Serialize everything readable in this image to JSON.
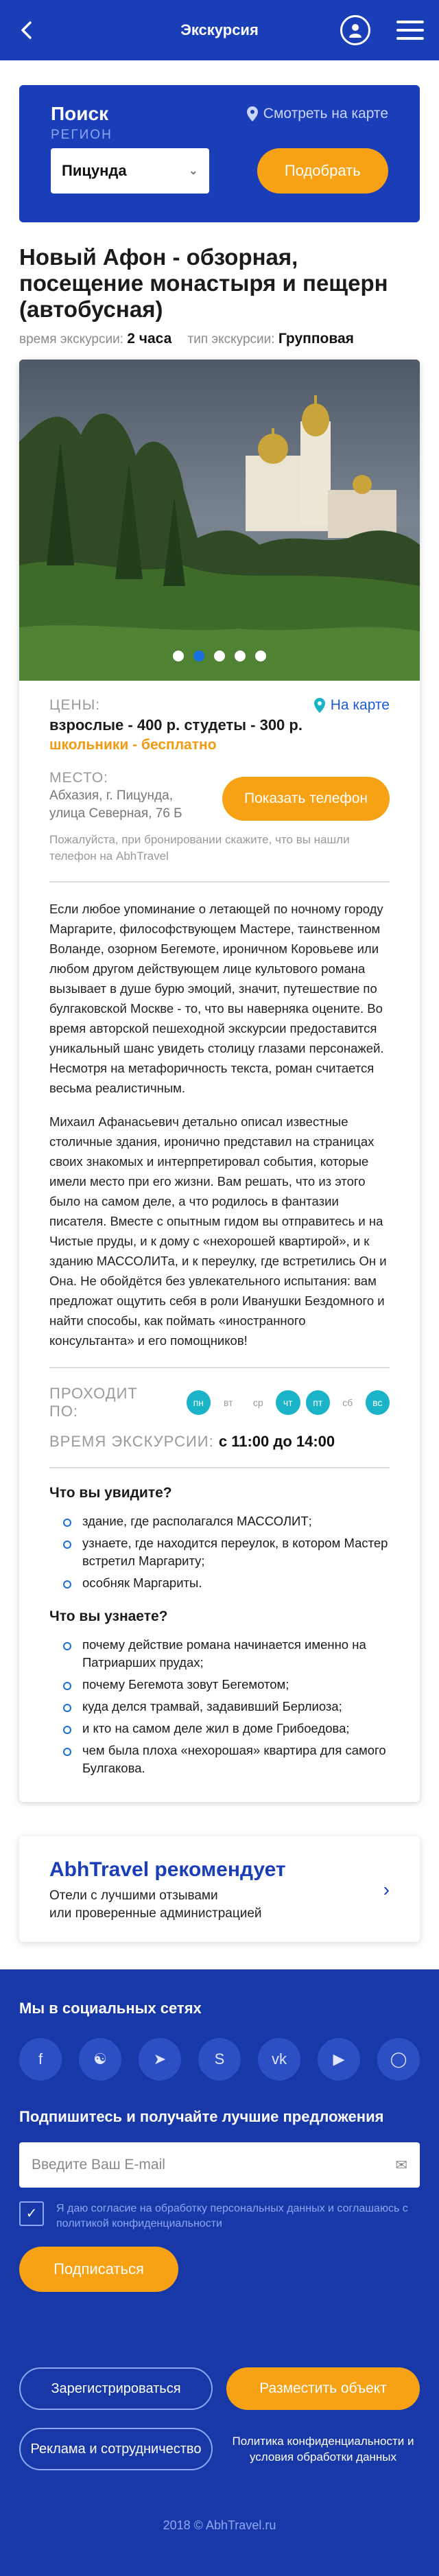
{
  "header": {
    "title": "Экскурсия",
    "back_icon": "chevron-left-icon",
    "user_icon": "user-icon",
    "menu_icon": "menu-icon"
  },
  "search": {
    "title": "Поиск",
    "map_link": "Смотреть на карте",
    "region_label": "РЕГИОН",
    "region_value": "Пицунда",
    "submit": "Подобрать"
  },
  "tour": {
    "title": "Новый Афон - обзорная, посещение монастыря и пещерн (автобусная)",
    "duration_label": "время экскурсии:",
    "duration_value": "2 часа",
    "type_label": "тип экскурсии:",
    "type_value": "Групповая",
    "slides_count": 5,
    "active_slide": 2,
    "prices_label": "ЦЕНЫ:",
    "on_map": "На карте",
    "prices": "взрослые - 400 р.   студеты - 300 р.",
    "free": "школьники - бесплатно",
    "place_label": "МЕСТО:",
    "address_line1": "Абхазия, г. Пицунда,",
    "address_line2": "улица Северная, 76 Б",
    "show_phone": "Показать телефон",
    "note": "Пожалуйста, при бронировании  скажите, что вы нашли телефон на AbhTravel",
    "desc_p1": "Если любое упоминание о летающей по ночному городу Маргарите, философствующем Мастере, таинственном Воланде, озорном Бегемоте, ироничном Коровьеве или любом другом действующем лице культового романа вызывает в душе бурю эмоций, значит, путешествие по булгаковской Москве - то, что вы наверняка оцените. Во время авторской пешеходной экскурсии предоставится уникальный шанс увидеть столицу глазами персонажей. Несмотря на метафоричность текста, роман считается весьма реалистичным.",
    "desc_p2": "Михаил Афанасьевич детально описал известные столичные здания, иронично представил на страницах своих знакомых и интерпретировал события, которые имели место при его жизни. Вам решать, что из этого было на самом деле, а что родилось в фантазии писателя. Вместе с опытным гидом вы отправитесь и на Чистые пруды, и к дому с «нехорошей квартирой», и к зданию МАССОЛИТа, и к переулку, где встретились Он и Она. Не обойдётся без увлекательного испытания: вам предложат ощутить себя в роли Иванушки Бездомного и найти способы, как поймать «иностранного консультанта» и его помощников!",
    "days_label": "ПРОХОДИТ ПО:",
    "days": [
      {
        "label": "пн",
        "on": true
      },
      {
        "label": "вт",
        "on": false
      },
      {
        "label": "ср",
        "on": false
      },
      {
        "label": "чт",
        "on": true
      },
      {
        "label": "пт",
        "on": true
      },
      {
        "label": "сб",
        "on": false
      },
      {
        "label": "вс",
        "on": true
      }
    ],
    "time_label": "ВРЕМЯ ЭКСКУРСИИ:",
    "time_value": "с 11:00 до 14:00",
    "see_title": "Что вы увидите?",
    "see_items": [
      "здание, где располагался МАССОЛИТ;",
      "узнаете, где находится переулок, в котором Мастер встретил Маргариту;",
      "особняк Маргариты."
    ],
    "learn_title": "Что вы узнаете?",
    "learn_items": [
      "почему действие романа начинается именно на Патриарших прудах;",
      "почему Бегемота зовут Бегемотом;",
      "куда делся трамвай, задавивший Берлиоза;",
      "и кто на самом деле жил в доме Грибоедова;",
      "чем была плоха «нехорошая» квартира для самого Булгакова."
    ]
  },
  "recommend": {
    "title": "AbhTravel рекомендует",
    "text_line1": "Отели с лучшими отзывами",
    "text_line2": "или проверенные администрацией"
  },
  "footer": {
    "social_title": "Мы в социальных сетях",
    "socials": [
      "facebook-icon",
      "odnoklassniki-icon",
      "telegram-icon",
      "skype-icon",
      "vk-icon",
      "youtube-icon",
      "instagram-icon"
    ],
    "subscribe_title": "Подпишитесь и получайте лучшие предложения",
    "email_placeholder": "Введите Ваш E-mail",
    "consent": "Я даю согласие на обработку персональных данных и соглашаюсь с политикой конфиденциальности",
    "subscribe": "Подписаться",
    "register": "Зарегистрироваться",
    "place_object": "Разместить объект",
    "ads": "Реклама и сотрудничество",
    "policy": "Политика конфиденциальности и условия обработки данных",
    "copyright": "2018 © AbhTravel.ru"
  }
}
